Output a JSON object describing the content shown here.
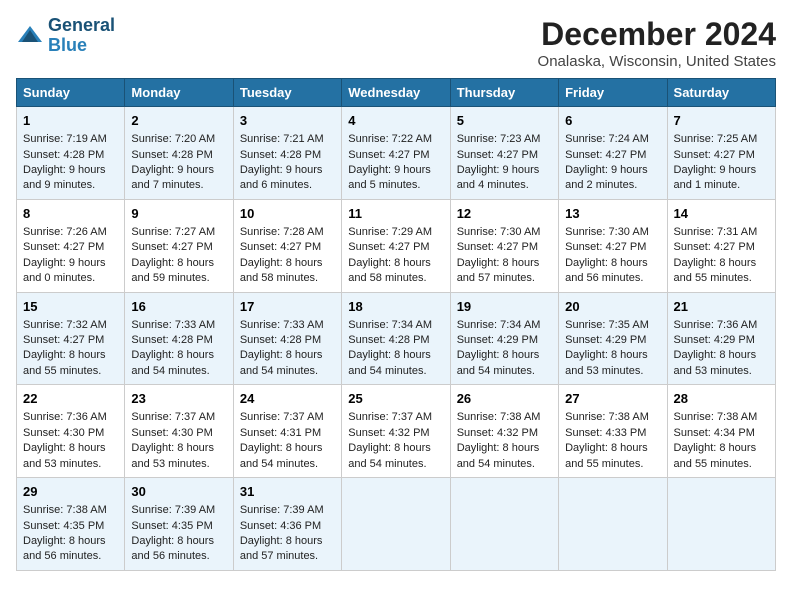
{
  "header": {
    "logo_line1": "General",
    "logo_line2": "Blue",
    "title": "December 2024",
    "subtitle": "Onalaska, Wisconsin, United States"
  },
  "days_of_week": [
    "Sunday",
    "Monday",
    "Tuesday",
    "Wednesday",
    "Thursday",
    "Friday",
    "Saturday"
  ],
  "weeks": [
    [
      {
        "day": "1",
        "info": "Sunrise: 7:19 AM\nSunset: 4:28 PM\nDaylight: 9 hours\nand 9 minutes."
      },
      {
        "day": "2",
        "info": "Sunrise: 7:20 AM\nSunset: 4:28 PM\nDaylight: 9 hours\nand 7 minutes."
      },
      {
        "day": "3",
        "info": "Sunrise: 7:21 AM\nSunset: 4:28 PM\nDaylight: 9 hours\nand 6 minutes."
      },
      {
        "day": "4",
        "info": "Sunrise: 7:22 AM\nSunset: 4:27 PM\nDaylight: 9 hours\nand 5 minutes."
      },
      {
        "day": "5",
        "info": "Sunrise: 7:23 AM\nSunset: 4:27 PM\nDaylight: 9 hours\nand 4 minutes."
      },
      {
        "day": "6",
        "info": "Sunrise: 7:24 AM\nSunset: 4:27 PM\nDaylight: 9 hours\nand 2 minutes."
      },
      {
        "day": "7",
        "info": "Sunrise: 7:25 AM\nSunset: 4:27 PM\nDaylight: 9 hours\nand 1 minute."
      }
    ],
    [
      {
        "day": "8",
        "info": "Sunrise: 7:26 AM\nSunset: 4:27 PM\nDaylight: 9 hours\nand 0 minutes."
      },
      {
        "day": "9",
        "info": "Sunrise: 7:27 AM\nSunset: 4:27 PM\nDaylight: 8 hours\nand 59 minutes."
      },
      {
        "day": "10",
        "info": "Sunrise: 7:28 AM\nSunset: 4:27 PM\nDaylight: 8 hours\nand 58 minutes."
      },
      {
        "day": "11",
        "info": "Sunrise: 7:29 AM\nSunset: 4:27 PM\nDaylight: 8 hours\nand 58 minutes."
      },
      {
        "day": "12",
        "info": "Sunrise: 7:30 AM\nSunset: 4:27 PM\nDaylight: 8 hours\nand 57 minutes."
      },
      {
        "day": "13",
        "info": "Sunrise: 7:30 AM\nSunset: 4:27 PM\nDaylight: 8 hours\nand 56 minutes."
      },
      {
        "day": "14",
        "info": "Sunrise: 7:31 AM\nSunset: 4:27 PM\nDaylight: 8 hours\nand 55 minutes."
      }
    ],
    [
      {
        "day": "15",
        "info": "Sunrise: 7:32 AM\nSunset: 4:27 PM\nDaylight: 8 hours\nand 55 minutes."
      },
      {
        "day": "16",
        "info": "Sunrise: 7:33 AM\nSunset: 4:28 PM\nDaylight: 8 hours\nand 54 minutes."
      },
      {
        "day": "17",
        "info": "Sunrise: 7:33 AM\nSunset: 4:28 PM\nDaylight: 8 hours\nand 54 minutes."
      },
      {
        "day": "18",
        "info": "Sunrise: 7:34 AM\nSunset: 4:28 PM\nDaylight: 8 hours\nand 54 minutes."
      },
      {
        "day": "19",
        "info": "Sunrise: 7:34 AM\nSunset: 4:29 PM\nDaylight: 8 hours\nand 54 minutes."
      },
      {
        "day": "20",
        "info": "Sunrise: 7:35 AM\nSunset: 4:29 PM\nDaylight: 8 hours\nand 53 minutes."
      },
      {
        "day": "21",
        "info": "Sunrise: 7:36 AM\nSunset: 4:29 PM\nDaylight: 8 hours\nand 53 minutes."
      }
    ],
    [
      {
        "day": "22",
        "info": "Sunrise: 7:36 AM\nSunset: 4:30 PM\nDaylight: 8 hours\nand 53 minutes."
      },
      {
        "day": "23",
        "info": "Sunrise: 7:37 AM\nSunset: 4:30 PM\nDaylight: 8 hours\nand 53 minutes."
      },
      {
        "day": "24",
        "info": "Sunrise: 7:37 AM\nSunset: 4:31 PM\nDaylight: 8 hours\nand 54 minutes."
      },
      {
        "day": "25",
        "info": "Sunrise: 7:37 AM\nSunset: 4:32 PM\nDaylight: 8 hours\nand 54 minutes."
      },
      {
        "day": "26",
        "info": "Sunrise: 7:38 AM\nSunset: 4:32 PM\nDaylight: 8 hours\nand 54 minutes."
      },
      {
        "day": "27",
        "info": "Sunrise: 7:38 AM\nSunset: 4:33 PM\nDaylight: 8 hours\nand 55 minutes."
      },
      {
        "day": "28",
        "info": "Sunrise: 7:38 AM\nSunset: 4:34 PM\nDaylight: 8 hours\nand 55 minutes."
      }
    ],
    [
      {
        "day": "29",
        "info": "Sunrise: 7:38 AM\nSunset: 4:35 PM\nDaylight: 8 hours\nand 56 minutes."
      },
      {
        "day": "30",
        "info": "Sunrise: 7:39 AM\nSunset: 4:35 PM\nDaylight: 8 hours\nand 56 minutes."
      },
      {
        "day": "31",
        "info": "Sunrise: 7:39 AM\nSunset: 4:36 PM\nDaylight: 8 hours\nand 57 minutes."
      },
      {
        "day": "",
        "info": ""
      },
      {
        "day": "",
        "info": ""
      },
      {
        "day": "",
        "info": ""
      },
      {
        "day": "",
        "info": ""
      }
    ]
  ]
}
